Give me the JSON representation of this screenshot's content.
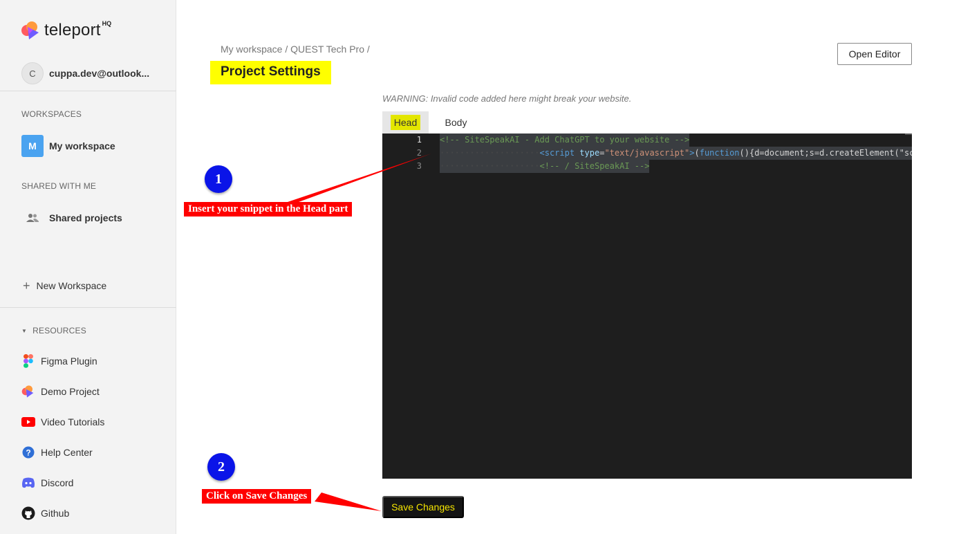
{
  "brand": {
    "name": "teleport",
    "suffix": "HQ"
  },
  "user": {
    "initial": "C",
    "email": "cuppa.dev@outlook..."
  },
  "sidebar": {
    "workspaces_label": "WORKSPACES",
    "workspace": {
      "initial": "M",
      "name": "My workspace"
    },
    "shared_label": "SHARED WITH ME",
    "shared_projects": "Shared projects",
    "new_workspace": "New Workspace",
    "resources_label": "RESOURCES",
    "resources": [
      {
        "label": "Figma Plugin",
        "icon": "figma-icon"
      },
      {
        "label": "Demo Project",
        "icon": "teleport-icon"
      },
      {
        "label": "Video Tutorials",
        "icon": "youtube-icon"
      },
      {
        "label": "Help Center",
        "icon": "help-icon"
      },
      {
        "label": "Discord",
        "icon": "discord-icon"
      },
      {
        "label": "Github",
        "icon": "github-icon"
      }
    ]
  },
  "main": {
    "breadcrumb": "My workspace / QUEST Tech Pro /",
    "title": "Project Settings",
    "open_editor": "Open Editor",
    "warning": "WARNING: Invalid code added here might break your website.",
    "tabs": {
      "head": "Head",
      "body": "Body"
    },
    "code_lines": {
      "l1": {
        "num": "1",
        "comment": "<!-- SiteSpeakAI - Add ChatGPT to your website -->"
      },
      "l2": {
        "num": "2",
        "tag_open": "<script ",
        "attr": "type",
        "eq": "=",
        "str": "\"text/javascript\"",
        "close": ">",
        "paren": "(",
        "fn": "function",
        "rest": "(){d=document;s=d.createElement(\"script\");s.src=\"https://sitespeak.ai/chatbot.js\";"
      },
      "l3": {
        "num": "3",
        "comment": "<!-- / SiteSpeakAI -->"
      }
    },
    "save_button": "Save Changes"
  },
  "annotations": {
    "step1": {
      "number": "1",
      "text": "Insert your snippet in the Head part"
    },
    "step2": {
      "number": "2",
      "text": "Click on Save Changes"
    }
  },
  "colors": {
    "highlight": "#ffff00",
    "callout": "#ff0000",
    "badge": "#0a14e8",
    "editor_bg": "#1e1e1e",
    "save_text": "#f5e500"
  }
}
